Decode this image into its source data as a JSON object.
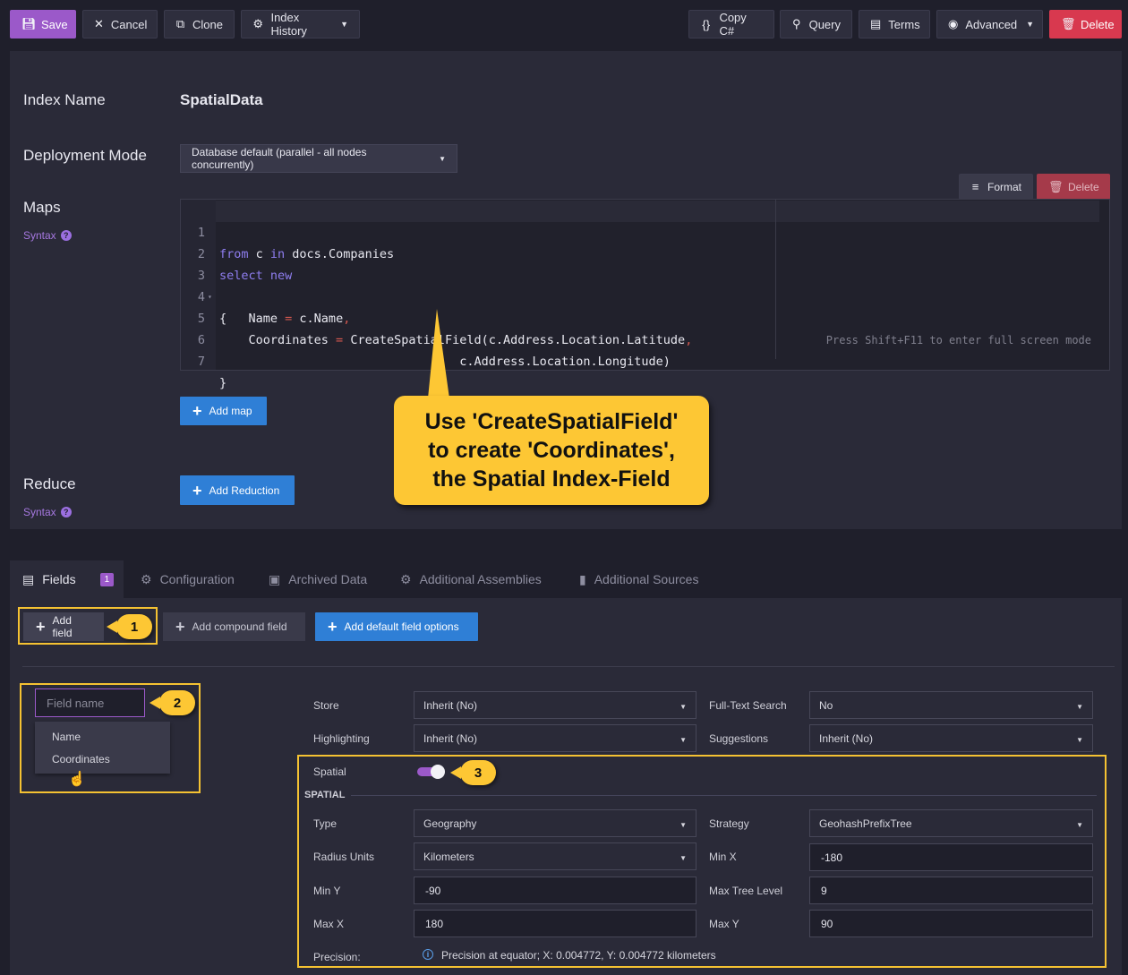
{
  "toolbar": {
    "save": "Save",
    "cancel": "Cancel",
    "clone": "Clone",
    "index_history": "Index History",
    "copy_csharp": "Copy C#",
    "query": "Query",
    "terms": "Terms",
    "advanced": "Advanced",
    "delete": "Delete"
  },
  "index": {
    "name_label": "Index Name",
    "name_value": "SpatialData",
    "deploy_label": "Deployment Mode",
    "deploy_value": "Database default (parallel - all nodes concurrently)",
    "maps_label": "Maps",
    "syntax": "Syntax",
    "format": "Format",
    "map_delete": "Delete",
    "add_map": "Add map",
    "reduce_label": "Reduce",
    "add_reduction": "Add Reduction"
  },
  "editor": {
    "hint": "Press Shift+F11 to enter full screen mode",
    "lines": [
      "1",
      "2",
      "3",
      "4",
      "5",
      "6",
      "7"
    ],
    "code": {
      "l1_kw1": "from",
      "l1_a": " c ",
      "l1_kw2": "in",
      "l1_b": " docs.Companies",
      "l2_kw1": "select",
      "l2_kw2": "new",
      "l3": "{",
      "l4_a": "    Name ",
      "l4_eq": "=",
      "l4_b": " c.Name",
      "l4_c": ",",
      "l5_a": "    Coordinates ",
      "l5_eq": "=",
      "l5_b": " CreateSpatialField(c.Address.Location.Latitude",
      "l5_c": ",",
      "l6": "                                 c.Address.Location.Longitude)",
      "l7": "}"
    }
  },
  "callout": {
    "line1": "Use 'CreateSpatialField'",
    "line2": "to create 'Coordinates',",
    "line3": "the Spatial Index-Field"
  },
  "tabs": {
    "fields": "Fields",
    "fields_count": "1",
    "configuration": "Configuration",
    "archived": "Archived Data",
    "assemblies": "Additional Assemblies",
    "sources": "Additional Sources"
  },
  "fields": {
    "add_field": "Add field",
    "add_compound": "Add compound field",
    "add_default": "Add default field options",
    "field_name_placeholder": "Field name",
    "suggestions": [
      "Name",
      "Coordinates"
    ],
    "markers": [
      "1",
      "2",
      "3"
    ],
    "store_label": "Store",
    "store_value": "Inherit (No)",
    "fts_label": "Full-Text Search",
    "fts_value": "No",
    "highlighting_label": "Highlighting",
    "highlighting_value": "Inherit (No)",
    "suggestions_label": "Suggestions",
    "suggestions_value": "Inherit (No)",
    "spatial_label": "Spatial",
    "spatial_on": true,
    "spatial_header": "SPATIAL",
    "type_label": "Type",
    "type_value": "Geography",
    "strategy_label": "Strategy",
    "strategy_value": "GeohashPrefixTree",
    "radius_label": "Radius Units",
    "radius_value": "Kilometers",
    "minx_label": "Min X",
    "minx_value": "-180",
    "miny_label": "Min Y",
    "miny_value": "-90",
    "maxtree_label": "Max Tree Level",
    "maxtree_value": "9",
    "maxx_label": "Max X",
    "maxx_value": "180",
    "maxy_label": "Max Y",
    "maxy_value": "90",
    "precision_label": "Precision:",
    "precision_value": "Precision at equator; X: 0.004772, Y: 0.004772 kilometers"
  },
  "colors": {
    "accent": "#9b59c9",
    "danger": "#d8394f",
    "primary": "#2f7fd6",
    "highlight": "#fdc734"
  }
}
